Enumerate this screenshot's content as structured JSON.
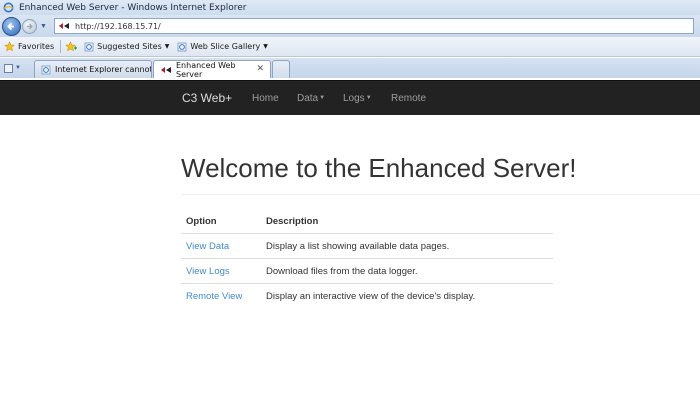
{
  "window": {
    "title": "Enhanced Web Server - Windows Internet Explorer"
  },
  "address_bar": {
    "url": "http://192.168.15.71/"
  },
  "favorites_bar": {
    "favorites_label": "Favorites",
    "suggested_sites_label": "Suggested Sites",
    "web_slice_gallery_label": "Web Slice Gallery"
  },
  "tabs": [
    {
      "label": "Internet Explorer cannot di..."
    },
    {
      "label": "Enhanced Web Server"
    }
  ],
  "site_nav": {
    "brand": "C3 Web+",
    "items": [
      {
        "label": "Home"
      },
      {
        "label": "Data"
      },
      {
        "label": "Logs"
      },
      {
        "label": "Remote"
      }
    ]
  },
  "main": {
    "heading": "Welcome to the Enhanced Server!",
    "table": {
      "headers": [
        "Option",
        "Description"
      ],
      "rows": [
        {
          "option": "View Data",
          "description": "Display a list showing available data pages."
        },
        {
          "option": "View Logs",
          "description": "Download files from the data logger."
        },
        {
          "option": "Remote View",
          "description": "Display an interactive view of the device's display."
        }
      ]
    }
  },
  "colors": {
    "navbar_bg": "#222222",
    "link": "#428bca",
    "brand_text": "#dddddd",
    "nav_text": "#9d9d9d"
  }
}
